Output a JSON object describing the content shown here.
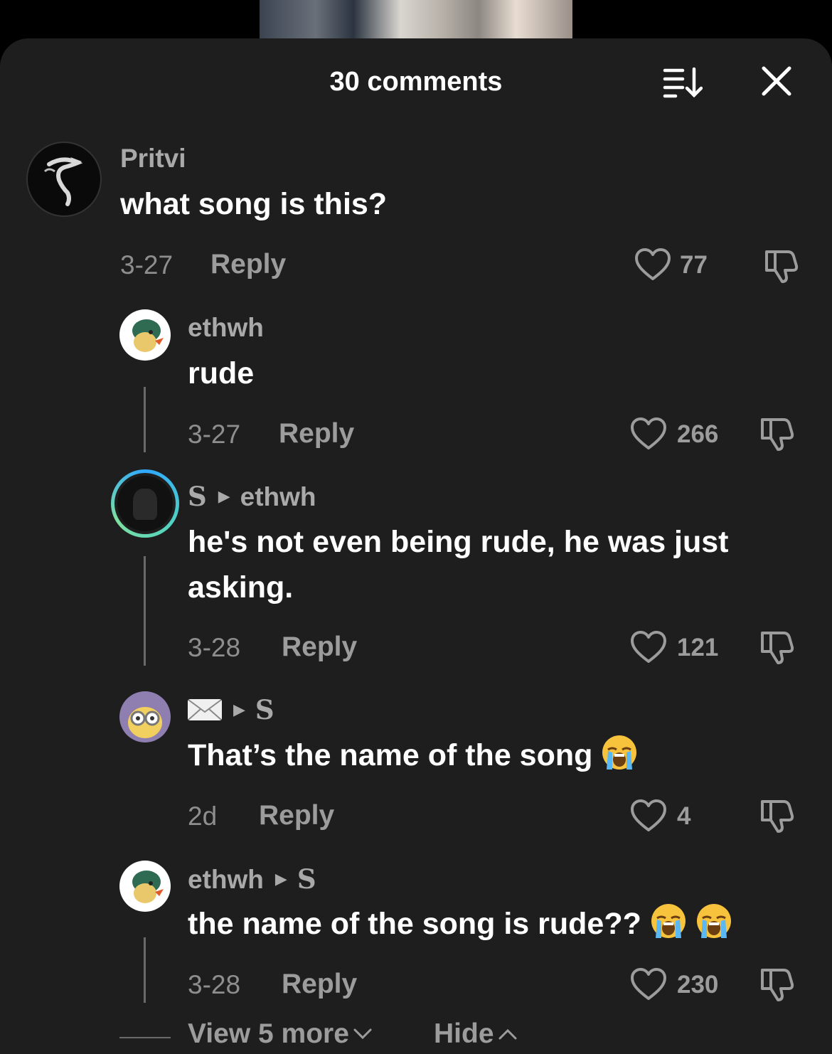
{
  "header": {
    "title": "30 comments"
  },
  "comments": [
    {
      "user": "Pritvi",
      "text": "what song is this?",
      "date": "3-27",
      "reply": "Reply",
      "likes": "77",
      "likes_shown": true
    },
    {
      "user": "ethwh",
      "text": "rude",
      "date": "3-27",
      "reply": "Reply",
      "likes": "266"
    },
    {
      "user": "S",
      "reply_to": "ethwh",
      "text_line1": "he's not even being rude, he was just",
      "text_line2": "asking.",
      "date": "3-28",
      "reply": "Reply",
      "likes": "121"
    },
    {
      "user": "✉",
      "reply_to": "S",
      "text": "That’s the name of the song",
      "date": "2d",
      "reply": "Reply",
      "likes": "4"
    },
    {
      "user": "ethwh",
      "reply_to": "S",
      "text": "the name of the song is rude??",
      "date": "3-28",
      "reply": "Reply",
      "likes": "230"
    }
  ],
  "footer": {
    "view_more": "View 5 more",
    "hide": "Hide"
  },
  "icons": {
    "sort": "sort-icon",
    "close": "close-icon",
    "like": "heart-icon",
    "dislike": "thumbs-down-icon",
    "emoji": "loudly-crying-face-emoji"
  }
}
